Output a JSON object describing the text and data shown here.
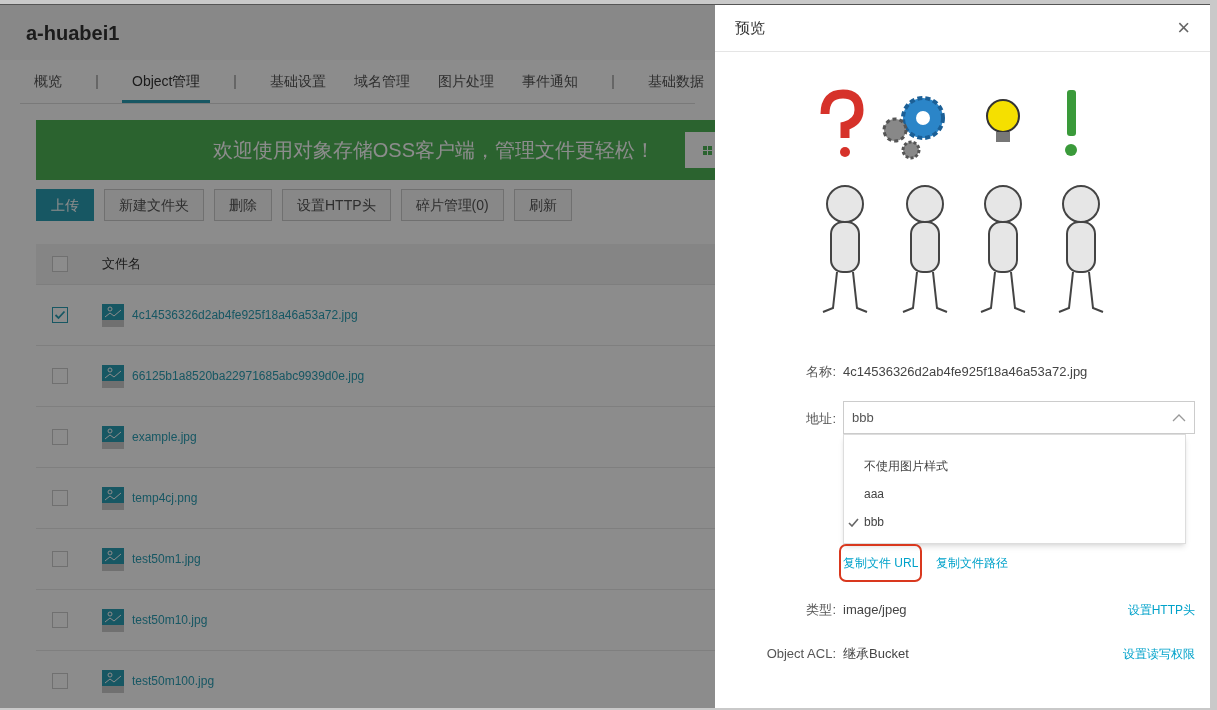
{
  "bucket": {
    "title": "a-huabei1"
  },
  "tabs": [
    {
      "label": "概览",
      "selected": false,
      "separator_after": true
    },
    {
      "label": "Object管理",
      "selected": true,
      "separator_after": true
    },
    {
      "label": "基础设置",
      "selected": false,
      "separator_after": false
    },
    {
      "label": "域名管理",
      "selected": false,
      "separator_after": false
    },
    {
      "label": "图片处理",
      "selected": false,
      "separator_after": false
    },
    {
      "label": "事件通知",
      "selected": false,
      "separator_after": true
    },
    {
      "label": "基础数据",
      "selected": false,
      "separator_after": false
    }
  ],
  "banner": {
    "text": "欢迎使用对象存储OSS客户端，管理文件更轻松！"
  },
  "toolbar": [
    {
      "label": "上传",
      "kind": "primary"
    },
    {
      "label": "新建文件夹",
      "kind": "default"
    },
    {
      "label": "删除",
      "kind": "default"
    },
    {
      "label": "设置HTTP头",
      "kind": "default"
    },
    {
      "label": "碎片管理(0)",
      "kind": "default"
    },
    {
      "label": "刷新",
      "kind": "default"
    }
  ],
  "table": {
    "header": {
      "checked": false,
      "column": "文件名"
    },
    "rows": [
      {
        "name": "4c14536326d2ab4fe925f18a46a53a72.jpg",
        "checked": true
      },
      {
        "name": "66125b1a8520ba22971685abc9939d0e.jpg",
        "checked": false
      },
      {
        "name": "example.jpg",
        "checked": false
      },
      {
        "name": "temp4cj.png",
        "checked": false
      },
      {
        "name": "test50m1.jpg",
        "checked": false
      },
      {
        "name": "test50m10.jpg",
        "checked": false
      },
      {
        "name": "test50m100.jpg",
        "checked": false
      }
    ]
  },
  "preview": {
    "title": "预览",
    "close": "×",
    "name_label": "名称:",
    "name_value": "4c14536326d2ab4fe925f18a46a53a72.jpg",
    "address_label": "地址:",
    "address_value": "bbb",
    "options": [
      {
        "label": "不使用图片样式",
        "selected": false
      },
      {
        "label": "aaa",
        "selected": false
      },
      {
        "label": "bbb",
        "selected": true
      }
    ],
    "links": [
      {
        "label": "复制文件 URL",
        "highlighted": true
      },
      {
        "label": "复制文件路径",
        "highlighted": false
      }
    ],
    "type_label": "类型:",
    "type_value": "image/jpeg",
    "type_link": "设置HTTP头",
    "acl_label": "Object ACL:",
    "acl_value": "继承Bucket",
    "acl_link": "设置读写权限"
  }
}
